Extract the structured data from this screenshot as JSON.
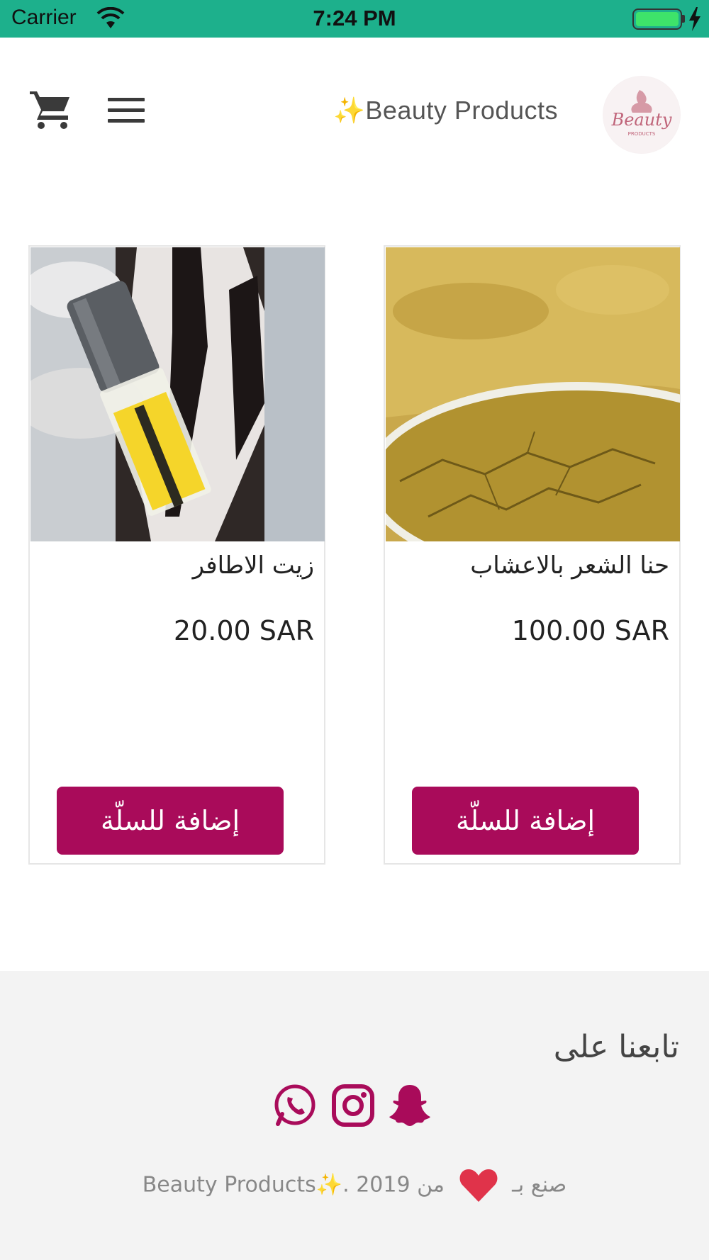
{
  "status_bar": {
    "carrier": "Carrier",
    "time": "7:24 PM",
    "battery_color": "#3ee36a"
  },
  "header": {
    "brand_title": "✨Beauty Products",
    "logo_alt": "Beauty",
    "cart_icon": "cart-icon",
    "menu_icon": "hamburger-menu-icon"
  },
  "products": [
    {
      "name": "زيت الاطافر",
      "price": "20.00 SAR",
      "add_label": "إضافة للسلّة",
      "image": "nail-oil-bottle-photo"
    },
    {
      "name": "حنا الشعر بالاعشاب",
      "price": "100.00 SAR",
      "add_label": "إضافة للسلّة",
      "image": "herbal-henna-powder-photo"
    }
  ],
  "footer": {
    "follow_title": "تابعنا على",
    "socials": [
      "snapchat-icon",
      "instagram-icon",
      "whatsapp-icon"
    ],
    "credit_prefix": "صنع بـ",
    "credit_suffix": "من 2019 .✨Beauty Products",
    "accent_color": "#a90b5a"
  }
}
